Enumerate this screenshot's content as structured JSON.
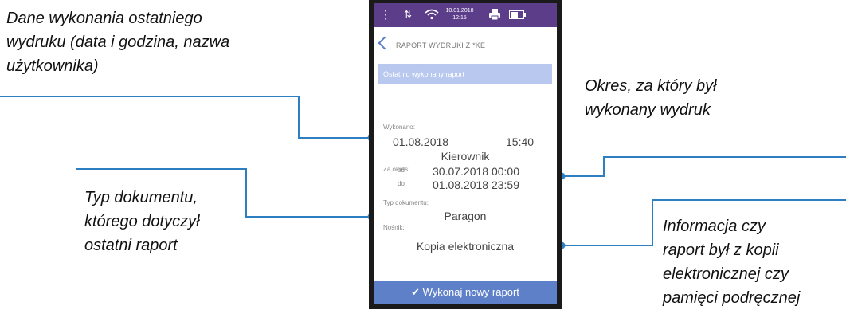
{
  "callouts": {
    "last_print": "Dane wykonania ostatniego\nwydruku (data i godzina, nazwa\nużytkownika)",
    "period": "Okres, za który był\nwykonany wydruk",
    "doc_type": "Typ dokumentu,\nktórego dotyczył\nostatni raport",
    "medium": "Informacja czy\nraport był z kopii\nelektronicznej czy\npamięci podręcznej"
  },
  "status_bar": {
    "date": "10.01.2018",
    "time": "12:15",
    "icons": [
      "menu-dots-icon",
      "signal-arrows-icon",
      "wifi-icon",
      "printer-icon",
      "battery-icon"
    ]
  },
  "screen": {
    "title": "RAPORT WYDRUKI Z *KE",
    "section_header": "Ostatnio wykonany raport",
    "executed_label": "Wykonano:",
    "executed_date": "01.08.2018",
    "executed_time": "15:40",
    "executed_user": "Kierownik",
    "period_label": "Za okres:",
    "from_label": "od",
    "from_value": "30.07.2018 00:00",
    "to_label": "do",
    "to_value": "01.08.2018 23:59",
    "doc_type_label": "Typ dokumentu:",
    "doc_type_value": "Paragon",
    "medium_label": "Nośnik:",
    "medium_value": "Kopia elektroniczna",
    "action_button": "✔ Wykonaj nowy raport"
  },
  "colors": {
    "status_bar": "#5b3d8a",
    "section_header": "#b8c8ef",
    "action_button": "#5d80c8",
    "callout_line": "#2e7fc2"
  }
}
